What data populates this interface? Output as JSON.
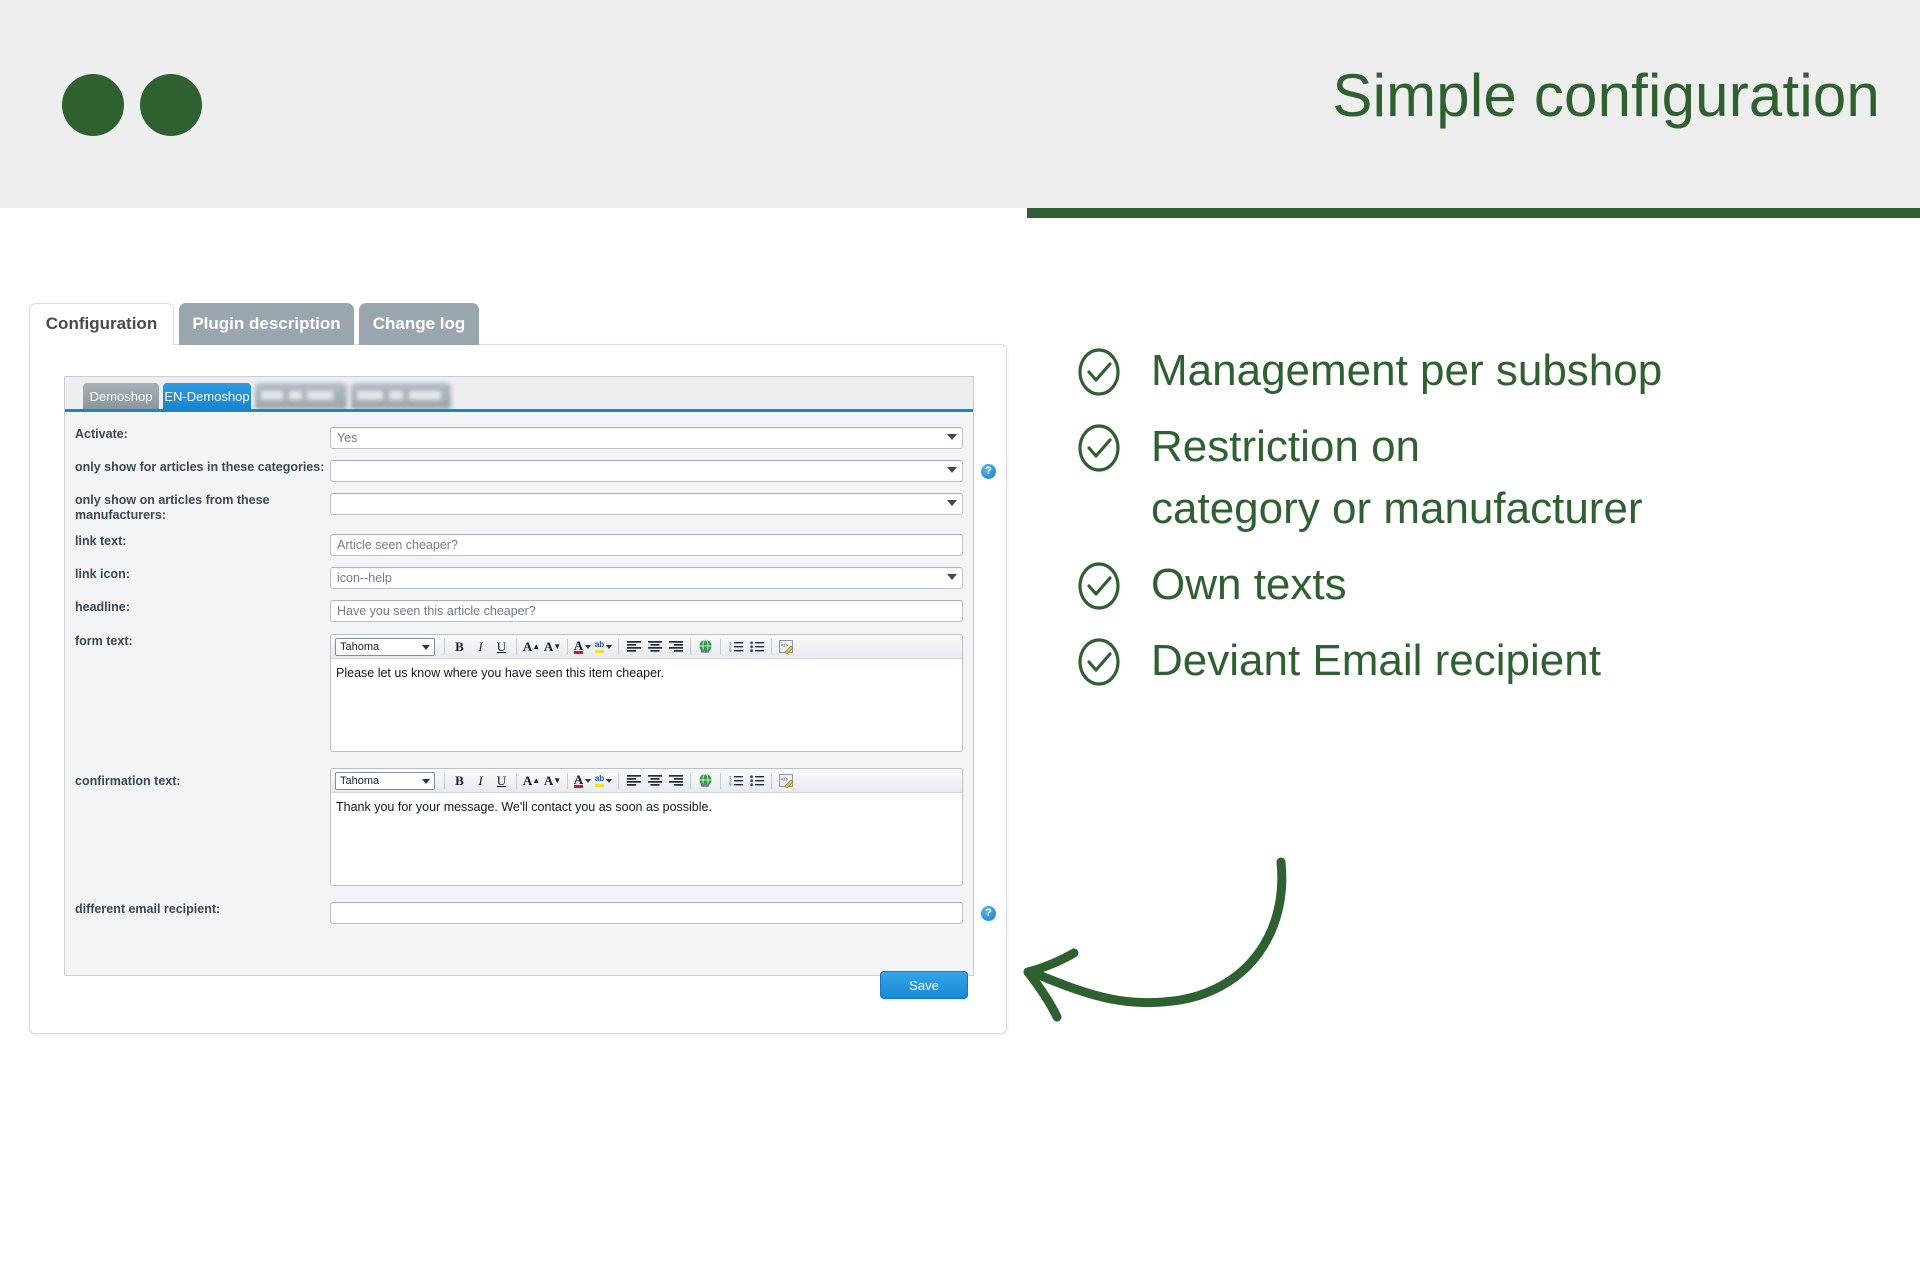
{
  "header": {
    "title": "Simple configuration",
    "logo_alt": "two-green-circles-logo",
    "accent_color": "#2f6130",
    "background_color": "#eeeeee"
  },
  "features": [
    {
      "icon": "check-circle-icon",
      "text": "Management per subshop"
    },
    {
      "icon": "check-circle-icon",
      "text": "Restriction on",
      "text2": "category or manufacturer"
    },
    {
      "icon": "check-circle-icon",
      "text": "Own texts"
    },
    {
      "icon": "check-circle-icon",
      "text": "Deviant Email recipient"
    }
  ],
  "annotation": {
    "arrow": "curved-arrow-pointing-left",
    "color": "#2f6130"
  },
  "screenshot": {
    "tabs": [
      {
        "label": "Configuration",
        "active": true
      },
      {
        "label": "Plugin description",
        "active": false
      },
      {
        "label": "Change log",
        "active": false
      }
    ],
    "shop_tabs": [
      {
        "label": "Demoshop",
        "state": "inactive"
      },
      {
        "label": "EN-Demoshop",
        "state": "active"
      },
      {
        "label": "",
        "state": "blurred"
      },
      {
        "label": "",
        "state": "blurred"
      }
    ],
    "fields": [
      {
        "label": "Activate:",
        "type": "select",
        "value": "Yes",
        "help": false
      },
      {
        "label": "only show for articles in these categories:",
        "type": "select",
        "value": "",
        "help": true
      },
      {
        "label": "only show on articles from these manufacturers:",
        "type": "select",
        "value": "",
        "help": false
      },
      {
        "label": "link text:",
        "type": "text",
        "value": "Article seen cheaper?",
        "help": false
      },
      {
        "label": "link icon:",
        "type": "select",
        "value": "icon--help",
        "help": false
      },
      {
        "label": "headline:",
        "type": "text",
        "value": "Have you seen this article cheaper?",
        "help": false
      }
    ],
    "editors": [
      {
        "label": "form text:",
        "font": "Tahoma",
        "content": "Please let us know where you have seen this item cheaper."
      },
      {
        "label": "confirmation text:",
        "font": "Tahoma",
        "content": "Thank you for your message. We'll contact you as soon as possible."
      }
    ],
    "email_field": {
      "label": "different email recipient:",
      "value": "",
      "help": true
    },
    "toolbar_icons": [
      "font-family-select",
      "bold-icon",
      "italic-icon",
      "underline-icon",
      "increase-font-size-icon",
      "decrease-font-size-icon",
      "font-color-icon",
      "highlight-color-icon",
      "align-left-icon",
      "align-center-icon",
      "align-right-icon",
      "insert-link-globe-icon",
      "ordered-list-icon",
      "unordered-list-icon",
      "edit-source-icon"
    ],
    "save_button": "Save",
    "help_icon_glyph": "?"
  }
}
